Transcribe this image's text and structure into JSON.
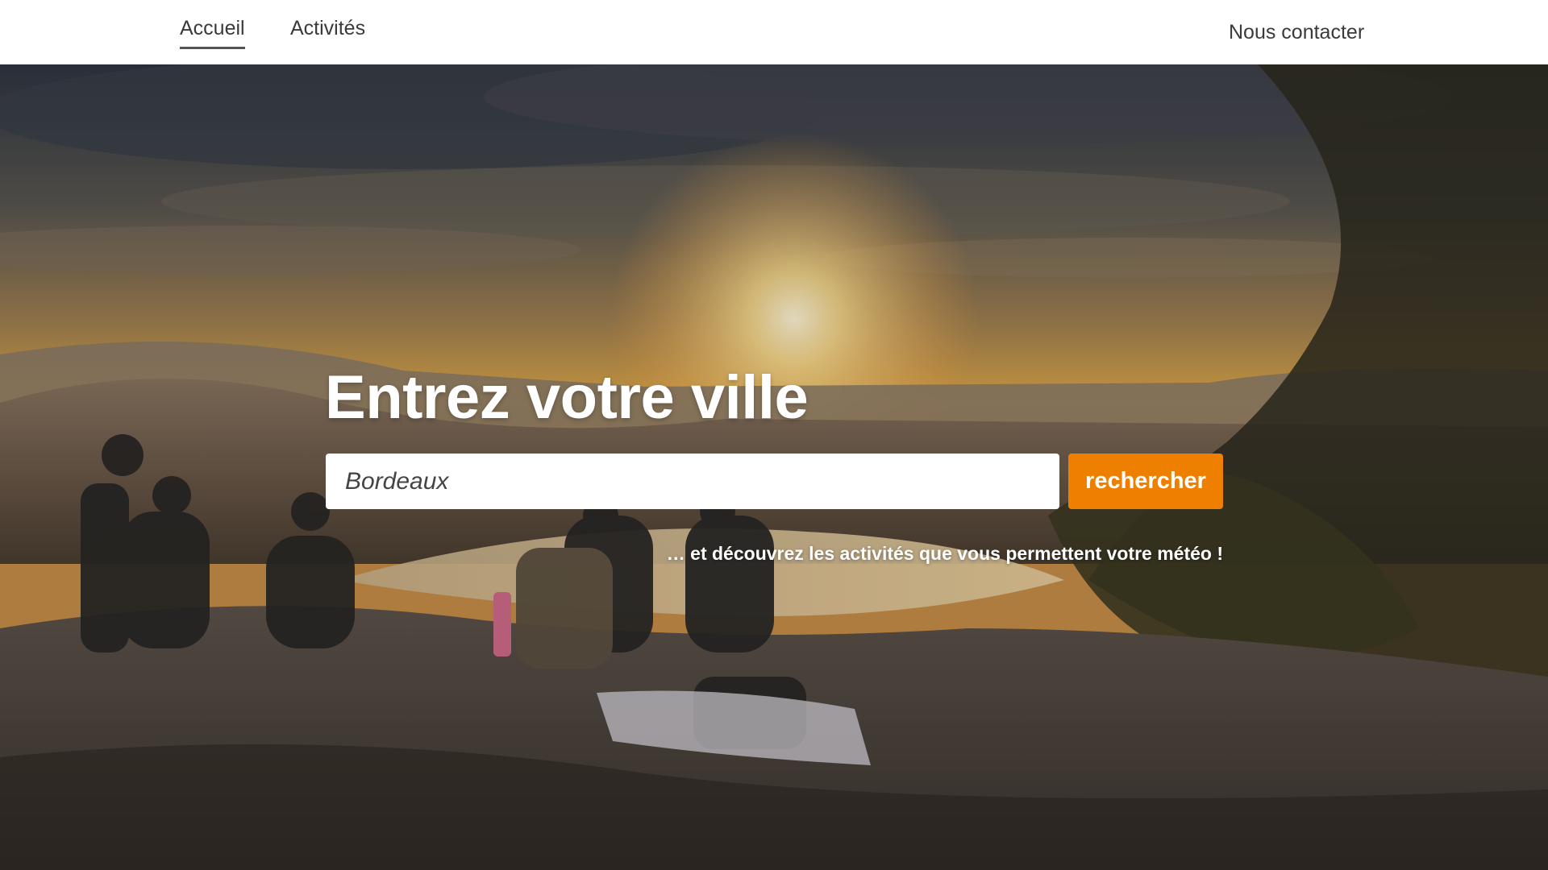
{
  "nav": {
    "home_label": "Accueil",
    "activities_label": "Activités",
    "contact_label": "Nous contacter"
  },
  "hero": {
    "title": "Entrez votre ville",
    "search": {
      "value": "Bordeaux",
      "placeholder": "Bordeaux"
    },
    "search_button_label": "rechercher",
    "subtitle": "… et découvrez les activités que vous permettent votre météo !",
    "background_image": "sunset-hilltop-photo"
  },
  "colors": {
    "accent": "#ee7f00",
    "nav_text": "#3a3a3a",
    "nav_background": "#ffffff",
    "hero_text": "#ffffff"
  }
}
